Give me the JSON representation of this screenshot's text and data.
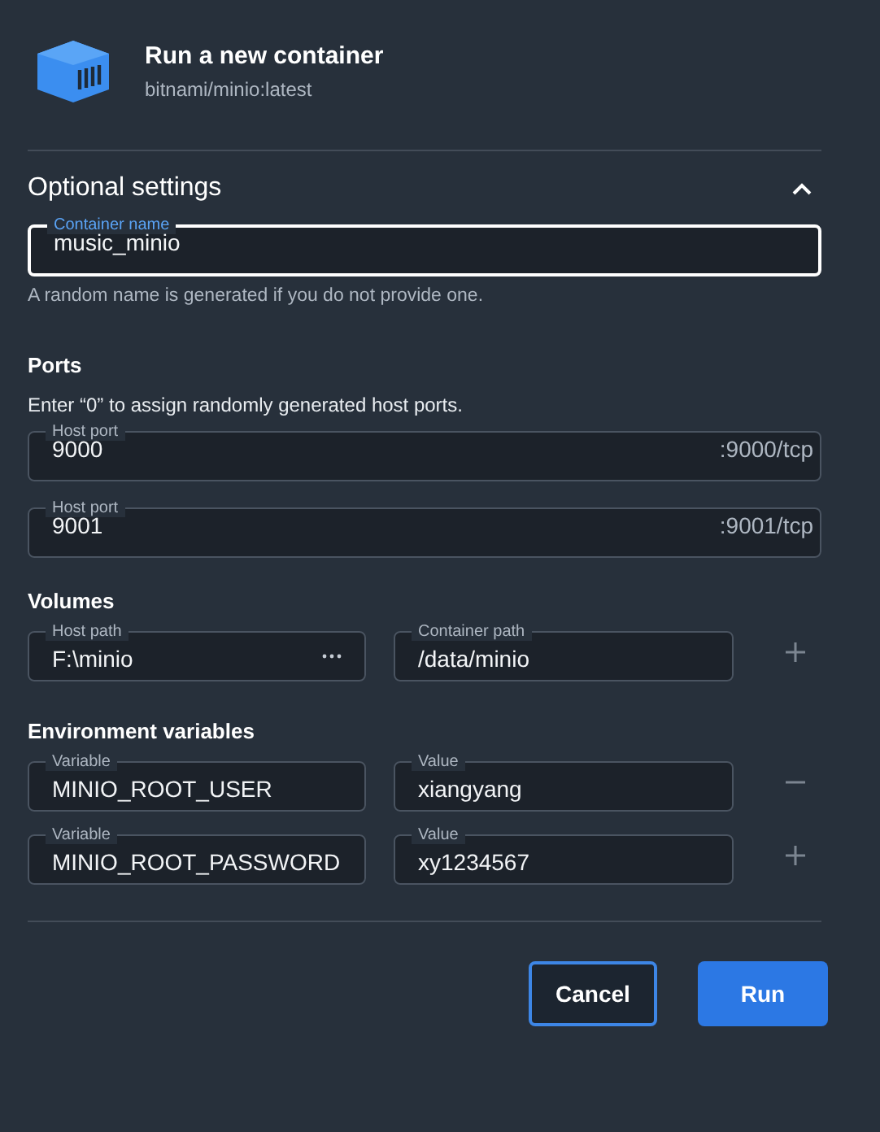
{
  "header": {
    "title": "Run a new container",
    "subtitle": "bitnami/minio:latest"
  },
  "optional_settings": {
    "title": "Optional settings",
    "expanded": true
  },
  "container_name": {
    "label": "Container name",
    "value": "music_minio",
    "focused": true
  },
  "container_name_hint": "A random name is generated if you do not provide one.",
  "ports": {
    "title": "Ports",
    "hint": "Enter “0” to assign randomly generated host ports.",
    "items": [
      {
        "label": "Host port",
        "value": "9000",
        "suffix": ":9000/tcp"
      },
      {
        "label": "Host port",
        "value": "9001",
        "suffix": ":9001/tcp"
      }
    ]
  },
  "volumes": {
    "title": "Volumes",
    "rows": [
      {
        "host_label": "Host path",
        "host_value": "F:\\minio",
        "container_label": "Container path",
        "container_value": "/data/minio",
        "kind": "add"
      }
    ]
  },
  "environment": {
    "title": "Environment variables",
    "rows": [
      {
        "name_label": "Variable",
        "name_value": "MINIO_ROOT_USER",
        "value_label": "Value",
        "value_value": "xiangyang",
        "kind": "remove"
      },
      {
        "name_label": "Variable",
        "name_value": "MINIO_ROOT_PASSWORD",
        "value_label": "Value",
        "value_value": "xy1234567",
        "kind": "add"
      }
    ]
  },
  "buttons": [
    {
      "label": "Cancel",
      "kind": "secondary"
    },
    {
      "label": "Run",
      "kind": "primary"
    }
  ]
}
